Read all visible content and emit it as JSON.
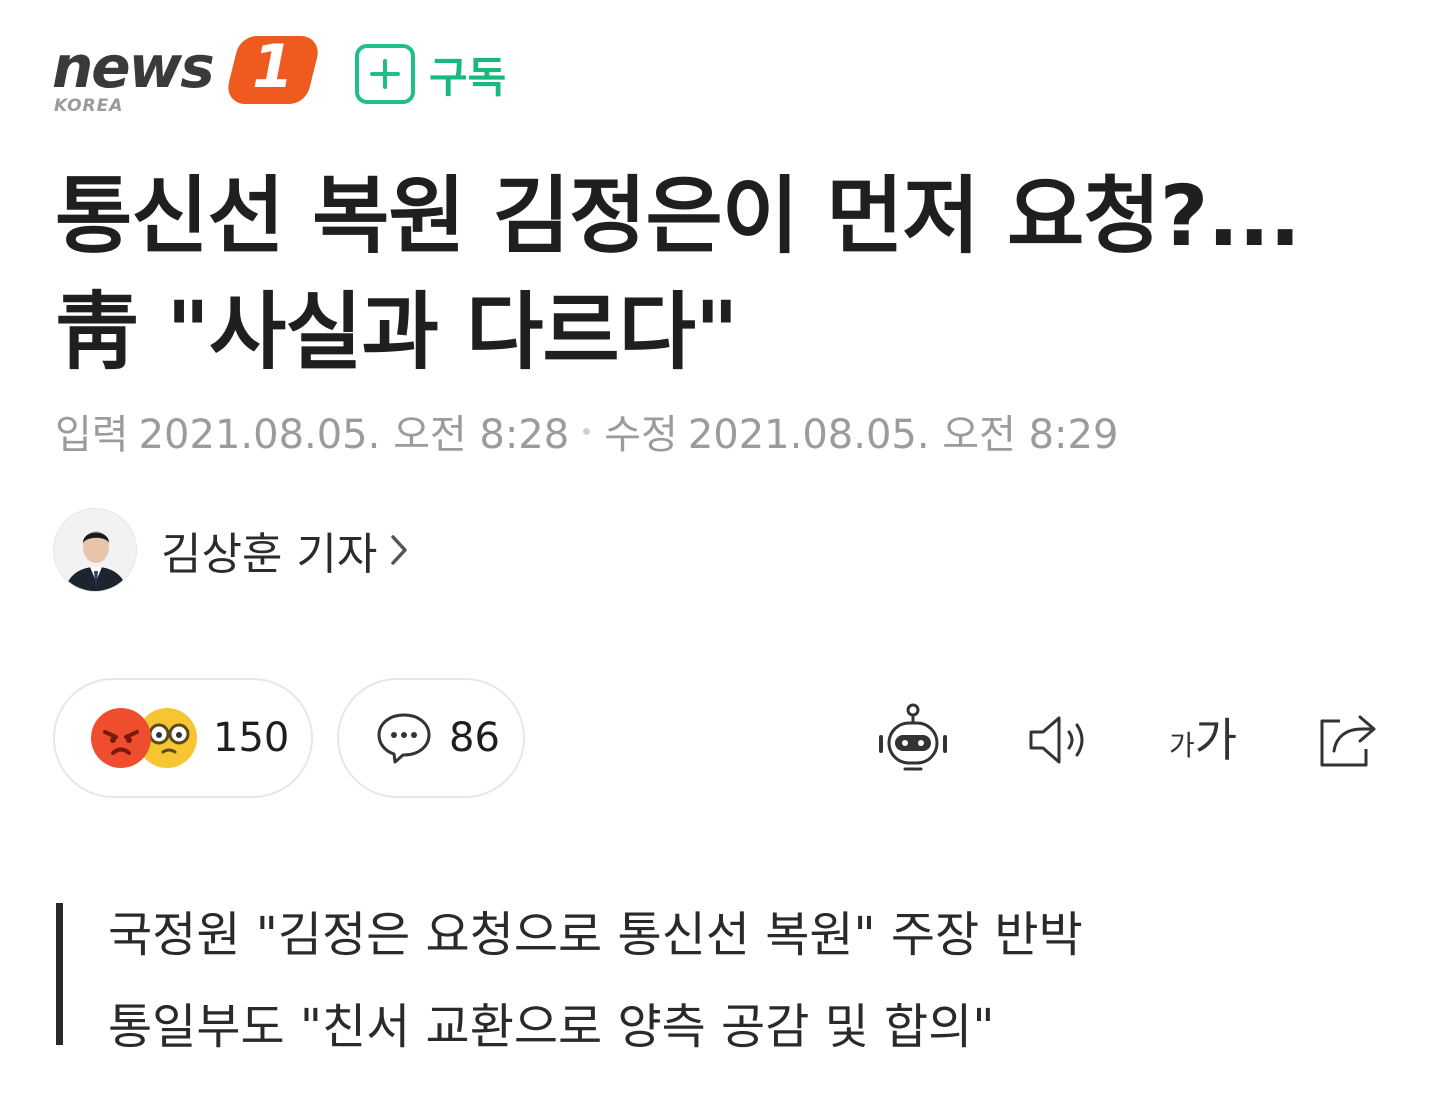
{
  "header": {
    "logo_text": "news",
    "logo_number": "1",
    "logo_sub": "KOREA",
    "subscribe_label": "구독",
    "accent_color": "#1fbf8a",
    "brand_color": "#ef5a1f"
  },
  "article": {
    "title_lines": [
      "통신선 복원 김정은이 먼저 요청?...",
      "靑 \"사실과 다르다\""
    ],
    "input_label": "입력",
    "input_datetime": "2021.08.05. 오전 8:28",
    "edit_label": "수정",
    "edit_datetime": "2021.08.05. 오전 8:29",
    "reporter": "김상훈 기자"
  },
  "actions": {
    "reactions_count": "150",
    "comments_count": "86",
    "tools": [
      "robot-summary-icon",
      "speaker-icon",
      "font-size-icon",
      "share-icon"
    ],
    "font_size_glyph_small": "가",
    "font_size_glyph_large": "가"
  },
  "summary": {
    "lines": [
      "국정원 \"김정은 요청으로 통신선 복원\" 주장 반박",
      "통일부도 \"친서 교환으로 양측 공감 및 합의\""
    ]
  }
}
